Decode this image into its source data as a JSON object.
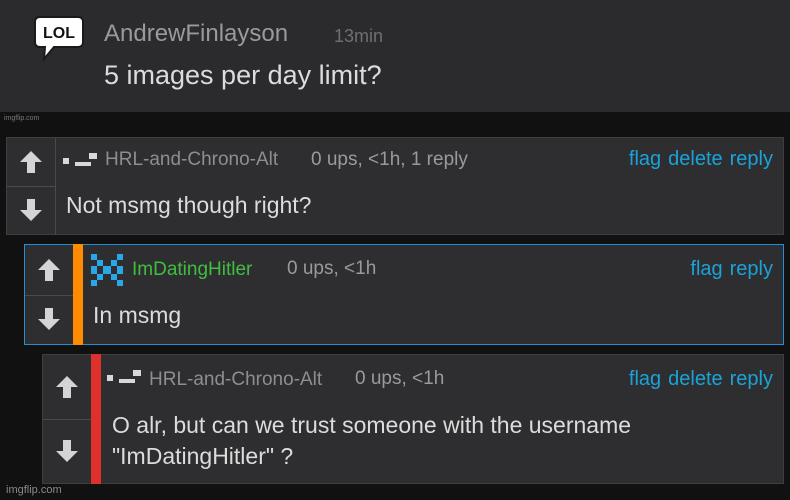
{
  "top": {
    "icon": "lol-speech-bubble-icon",
    "icon_text": "LOL",
    "username": "AndrewFinlayson",
    "time": "13min",
    "text": "5 images per day limit?",
    "small_watermark": "imgflip.com"
  },
  "comments": [
    {
      "username": "HRL-and-Chrono-Alt",
      "meta": "0 ups, <1h, 1 reply",
      "actions": [
        "flag",
        "delete",
        "reply"
      ],
      "text": "Not msmg though right?"
    },
    {
      "username": "ImDatingHitler",
      "meta": "0 ups, <1h",
      "actions": [
        "flag",
        "reply"
      ],
      "text": "In msmg"
    },
    {
      "username": "HRL-and-Chrono-Alt",
      "meta": "0 ups, <1h",
      "actions": [
        "flag",
        "delete",
        "reply"
      ],
      "text_line1": "O alr, but can we trust someone with the username",
      "text_line2": "\"ImDatingHitler\" ?"
    }
  ],
  "watermark": "imgflip.com",
  "colors": {
    "link": "#1aa3d9",
    "green_user": "#3fbf3f",
    "stripe_orange": "#ff8c00",
    "stripe_red": "#e0302c",
    "highlight_border": "#1f8fd6"
  }
}
